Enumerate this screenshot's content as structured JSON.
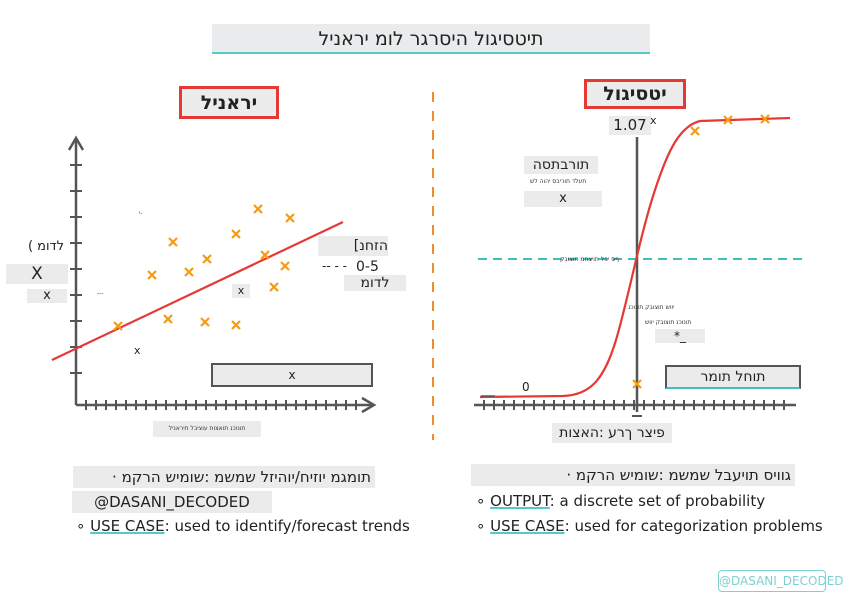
{
  "title": "תיטסיגול היסרגר לומ יראניל",
  "linear": {
    "header": "יראניל",
    "y_axis_label": "לדומ )",
    "y_axis_x": "X",
    "small_x_left": "x",
    "small_x_mid": "x",
    "small_x_low": "x",
    "tiny_top": "י-",
    "tiny_left": "---",
    "data_label_line1": "הזחנ]",
    "data_label_line2": "0-5",
    "data_label_dashes": "-- - -",
    "data_label_line3": "לדומ",
    "bottom_box_label": "x",
    "x_axis_tiny": "תונוכנ תואצות עוציבל תיראניל",
    "bullet_primary": "תומגמ יוזיח/יוהיזל שמשמ :שומיש הרקמ",
    "credit": "@DASANI_DECODED",
    "use_case_label": "USE CASE",
    "use_case_text": ": used to identify/forecast trends",
    "points": [
      [
        118,
        326
      ],
      [
        173,
        242
      ],
      [
        152,
        275
      ],
      [
        189,
        272
      ],
      [
        207,
        259
      ],
      [
        236,
        234
      ],
      [
        258,
        209
      ],
      [
        290,
        218
      ],
      [
        265,
        255
      ],
      [
        285,
        266
      ],
      [
        274,
        287
      ],
      [
        241,
        291
      ],
      [
        168,
        319
      ],
      [
        205,
        322
      ],
      [
        236,
        325
      ]
    ]
  },
  "logistic": {
    "header": "יטסיגול",
    "value_top": "1.07",
    "value_top_x": "x",
    "value_zero": "0",
    "prob_title": "תורבתסה",
    "prob_tiny": "תעלד תוריבס יהוה לש",
    "prob_x": "x",
    "threshold_tiny": "ףס יפל תויצחמ תוצובק",
    "mid_tiny_1": "יווש תוצובק תונוכנ",
    "mid_tiny_2": "תונוכנ תוצובק יווש",
    "mid_star": "*_",
    "result_box": "תוחל תומר",
    "x_axis_label": "פיצר ךרע :האצות",
    "bullet_primary": "גוויס תויעבל שמשמ :שומיש הרקמ",
    "output_label": "OUTPUT",
    "output_text": ": a discrete set of probability",
    "use_case_label": "USE CASE",
    "use_case_text": ": used for categorization problems",
    "markers": [
      [
        637,
        384
      ],
      [
        695,
        131
      ],
      [
        728,
        120
      ],
      [
        765,
        119
      ]
    ]
  },
  "watermark": "@DASANI_DECODED",
  "colors": {
    "red": "#e53935",
    "orange": "#f39c12",
    "teal": "#3fbfbf",
    "divider": "#f08c2e"
  }
}
